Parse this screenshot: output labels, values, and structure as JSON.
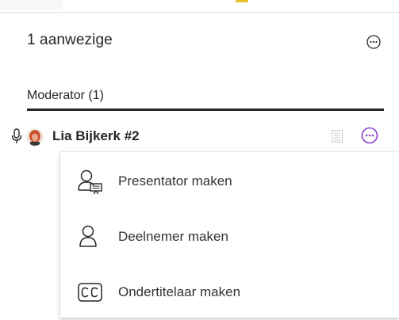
{
  "header": {
    "title": "1 aanwezige",
    "more_icon": "more-options-icon"
  },
  "section": {
    "title": "Moderator (1)"
  },
  "participant": {
    "name": "Lia Bijkerk #2",
    "mic_icon": "microphone-icon",
    "avatar_icon": "avatar",
    "notes_icon": "notes-icon",
    "more_icon": "more-options-icon"
  },
  "menu": {
    "items": [
      {
        "label": "Presentator maken",
        "icon": "presenter-icon"
      },
      {
        "label": "Deelnemer maken",
        "icon": "participant-icon"
      },
      {
        "label": "Ondertitelaar maken",
        "icon": "captioner-cc-icon"
      }
    ]
  },
  "colors": {
    "accent": "#8b3ccf",
    "text": "#262626",
    "top_accent": "#e8c22e"
  }
}
